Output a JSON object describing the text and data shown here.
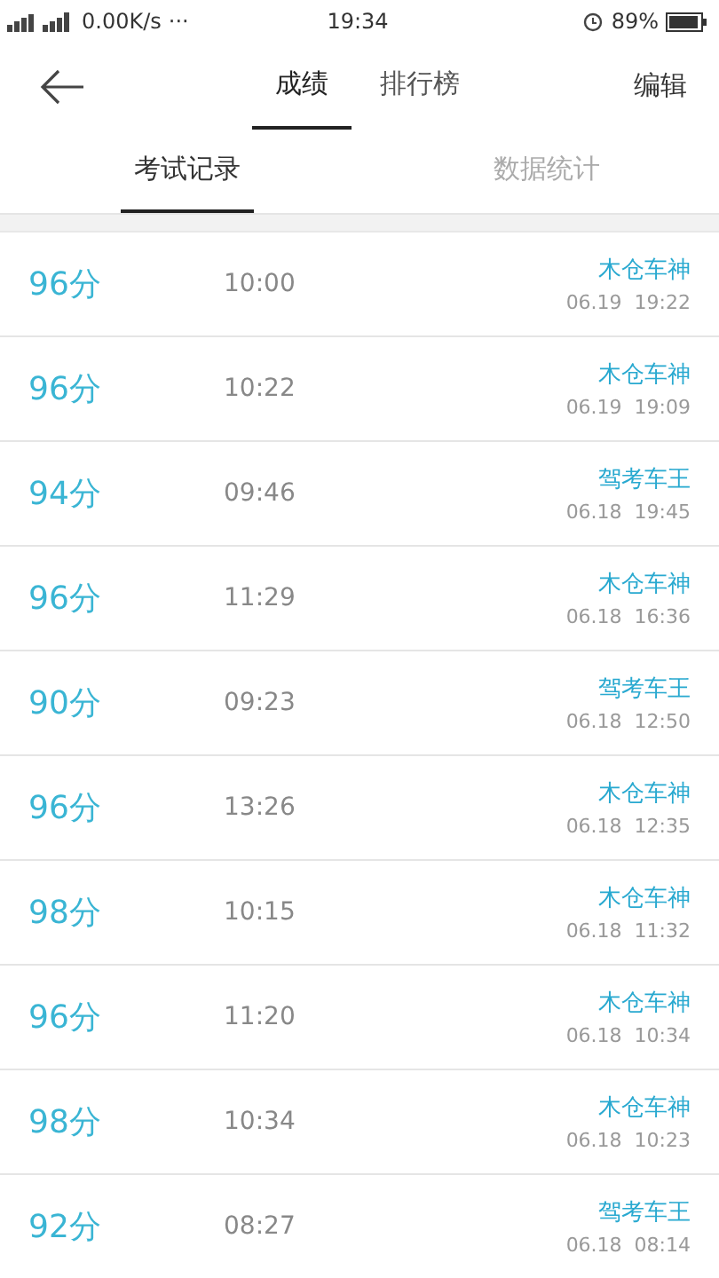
{
  "status_bar": {
    "speed": "0.00K/s",
    "dots": "···",
    "time": "19:34",
    "battery": "89%"
  },
  "nav": {
    "tabs": [
      {
        "label": "成绩",
        "selected": true
      },
      {
        "label": "排行榜",
        "selected": false
      }
    ],
    "edit": "编辑"
  },
  "subtabs": [
    {
      "label": "考试记录",
      "selected": true
    },
    {
      "label": "数据统计",
      "selected": false
    }
  ],
  "records": [
    {
      "score": "96分",
      "duration": "10:00",
      "title": "木仓车神",
      "date": "06.19  19:22"
    },
    {
      "score": "96分",
      "duration": "10:22",
      "title": "木仓车神",
      "date": "06.19  19:09"
    },
    {
      "score": "94分",
      "duration": "09:46",
      "title": "驾考车王",
      "date": "06.18  19:45"
    },
    {
      "score": "96分",
      "duration": "11:29",
      "title": "木仓车神",
      "date": "06.18  16:36"
    },
    {
      "score": "90分",
      "duration": "09:23",
      "title": "驾考车王",
      "date": "06.18  12:50"
    },
    {
      "score": "96分",
      "duration": "13:26",
      "title": "木仓车神",
      "date": "06.18  12:35"
    },
    {
      "score": "98分",
      "duration": "10:15",
      "title": "木仓车神",
      "date": "06.18  11:32"
    },
    {
      "score": "96分",
      "duration": "11:20",
      "title": "木仓车神",
      "date": "06.18  10:34"
    },
    {
      "score": "98分",
      "duration": "10:34",
      "title": "木仓车神",
      "date": "06.18  10:23"
    },
    {
      "score": "92分",
      "duration": "08:27",
      "title": "驾考车王",
      "date": "06.18  08:14"
    }
  ]
}
